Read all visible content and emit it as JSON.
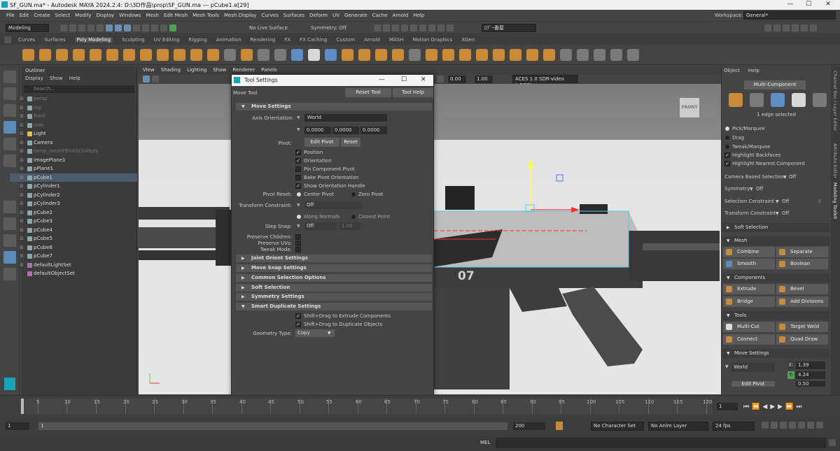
{
  "window": {
    "title": "SF_GUN.ma* - Autodesk MAYA 2024.2.4: D:\\3D作品\\prop\\SF_GUN.ma   ---   pCube1.e[29]",
    "min": "—",
    "max": "☐",
    "close": "✕",
    "restore": "⧉",
    "minimize2": "—"
  },
  "menubar": {
    "items": [
      "File",
      "Edit",
      "Create",
      "Select",
      "Modify",
      "Display",
      "Windows",
      "Mesh",
      "Edit Mesh",
      "Mesh Tools",
      "Mesh Display",
      "Curves",
      "Surfaces",
      "Deform",
      "UV",
      "Generate",
      "Cache",
      "Arnold",
      "Help"
    ],
    "workspace_label": "Workspace:",
    "workspace_value": "General*"
  },
  "statusline": {
    "mode": "Modeling",
    "live_surface": "No Live Surface",
    "symmetry": "Symmetry: Off",
    "user": "ﾛｸﾞｰ番屋"
  },
  "shelf": {
    "tabs": [
      "Curves",
      "Surfaces",
      "Poly Modeling",
      "Sculpting",
      "UV Editing",
      "Rigging",
      "Animation",
      "Rendering",
      "FX",
      "FX Caching",
      "Custom",
      "Arnold",
      "MASH",
      "Motion Graphics",
      "XGen"
    ],
    "active": "Poly Modeling"
  },
  "outliner": {
    "title": "Outliner",
    "menu": [
      "Display",
      "Show",
      "Help"
    ],
    "search_placeholder": "Search...",
    "items": [
      "persp",
      "top",
      "front",
      "side",
      "Light",
      "Camera",
      "temp_meshFBXASC046ply",
      "imagePlane1",
      "pPlane1",
      "pCube1",
      "pCylinder1",
      "pCylinder2",
      "pCylinder3",
      "pCube2",
      "pCube3",
      "pCube4",
      "pCube5",
      "pCube6",
      "pCube7",
      "defaultLightSet",
      "defaultObjectSet"
    ]
  },
  "viewport": {
    "menu": [
      "View",
      "Shading",
      "Lighting",
      "Show",
      "Renderer",
      "Panels"
    ],
    "exposure": "0.00",
    "gamma": "1.00",
    "colorspace": "ACES 1.0 SDR-video (sRGB)",
    "view_cube": "FRONT",
    "gun_number": "07"
  },
  "tool_settings": {
    "title": "Tool Settings",
    "tool_name": "Move Tool",
    "reset_tool": "Reset Tool",
    "tool_help": "Tool Help",
    "move_settings": "Move Settings",
    "axis_orientation_label": "Axis Orientation:",
    "axis_orientation_value": "World",
    "vec": [
      "0.0000",
      "0.0000",
      "0.0000"
    ],
    "pivot_label": "Pivot:",
    "edit_pivot": "Edit Pivot",
    "reset": "Reset",
    "pivot_checks": [
      "Position",
      "Orientation",
      "Pin Component Pivot",
      "Bake Pivot Orientation",
      "Show Orientation Handle"
    ],
    "pivot_reset_label": "Pivot Reset:",
    "center_pivot": "Center Pivot",
    "zero_pivot": "Zero Pivot",
    "transform_constraint_label": "Transform Constraint:",
    "transform_constraint_value": "Off",
    "along_normals": "Along Normals",
    "closest_point": "Closest Point",
    "step_snap_label": "Step Snap:",
    "step_snap_value": "Off",
    "step_snap_num": "1.00",
    "preserve_children": "Preserve Children:",
    "preserve_uvs": "Preserve UVs:",
    "tweak_mode": "Tweak Mode:",
    "sections": [
      "Joint Orient Settings",
      "Move Snap Settings",
      "Common Selection Options",
      "Soft Selection",
      "Symmetry Settings",
      "Smart Duplicate Settings"
    ],
    "dup_checks": [
      "Shift+Drag to Extrude Components",
      "Shift+Drag to Duplicate Objects"
    ],
    "geometry_type_label": "Geometry Type:",
    "geometry_type_value": "Copy"
  },
  "right_panel": {
    "menu": [
      "Object",
      "Help"
    ],
    "multi_component": "Multi-Component",
    "selection_info": "1 edge selected",
    "radios": [
      "Pick/Marquee",
      "Drag",
      "Tweak/Marquee"
    ],
    "checks": [
      "Highlight Backfaces",
      "Highlight Nearest Component"
    ],
    "camera_based": "Camera Based Selection",
    "camera_based_val": "Off",
    "symmetry": "Symmetry",
    "symmetry_val": "Off",
    "sel_constraint": "Selection Constraint",
    "sel_constraint_val": "Off",
    "sel_constraint_num": "0",
    "trans_constraint": "Transform Constraint",
    "trans_constraint_val": "Off",
    "soft_selection": "Soft Selection",
    "mesh_head": "Mesh",
    "mesh": [
      "Combine",
      "Separate",
      "Smooth",
      "Boolean"
    ],
    "components_head": "Components",
    "components": [
      "Extrude",
      "Bevel",
      "Bridge",
      "Add Divisions"
    ],
    "tools_head": "Tools",
    "tools": [
      "Multi-Cut",
      "Target Weld",
      "Connect",
      "Quad Draw"
    ],
    "move_settings_head": "Move Settings",
    "move_world": "World",
    "x_label": "X:",
    "x_val": "1.39",
    "y_label": "Y:",
    "y_val": "4.24",
    "z_val": "0.50",
    "edit_pivot": "Edit Pivot"
  },
  "side_tabs": [
    "Channel Box / Layer Editor",
    "Attribute Editor",
    "Modeling Toolkit"
  ],
  "timeline": {
    "ticks": [
      "5",
      "10",
      "15",
      "20",
      "25",
      "30",
      "35",
      "40",
      "45",
      "50",
      "55",
      "60",
      "65",
      "70",
      "75",
      "80",
      "85",
      "90",
      "95",
      "100",
      "105",
      "110",
      "115",
      "120"
    ],
    "current_frame": "1",
    "range_start": "1",
    "range_inner": "1",
    "range_end": "200",
    "character_set": "No Character Set",
    "anim_layer": "No Anim Layer",
    "fps": "24 fps"
  },
  "cmdline": {
    "label": "MEL"
  },
  "colors": {
    "accent": "#5a8ab8",
    "orange": "#c98a3a",
    "selected": "#4b5b6b"
  }
}
